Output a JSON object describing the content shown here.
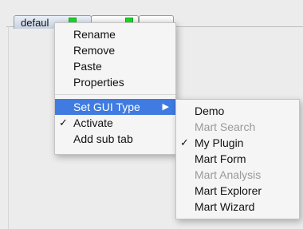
{
  "tabs": [
    {
      "label": "defaul"
    },
    {
      "label": ""
    },
    {
      "label": ""
    }
  ],
  "context_menu": {
    "items": [
      {
        "label": "Rename"
      },
      {
        "label": "Remove"
      },
      {
        "label": "Paste"
      },
      {
        "label": "Properties"
      },
      {
        "label": "Set GUI Type",
        "submenu_arrow": "▶"
      },
      {
        "label": "Activate",
        "check": "✓"
      },
      {
        "label": "Add sub tab"
      }
    ]
  },
  "gui_type_submenu": {
    "items": [
      {
        "label": "Demo"
      },
      {
        "label": "Mart Search"
      },
      {
        "label": "My Plugin",
        "check": "✓"
      },
      {
        "label": "Mart Form"
      },
      {
        "label": "Mart Analysis"
      },
      {
        "label": "Mart Explorer"
      },
      {
        "label": "Mart Wizard"
      }
    ]
  },
  "colors": {
    "highlight": "#3f7be0",
    "tab_indicator": "#22d32a",
    "disabled_text": "#9a9a9a"
  }
}
